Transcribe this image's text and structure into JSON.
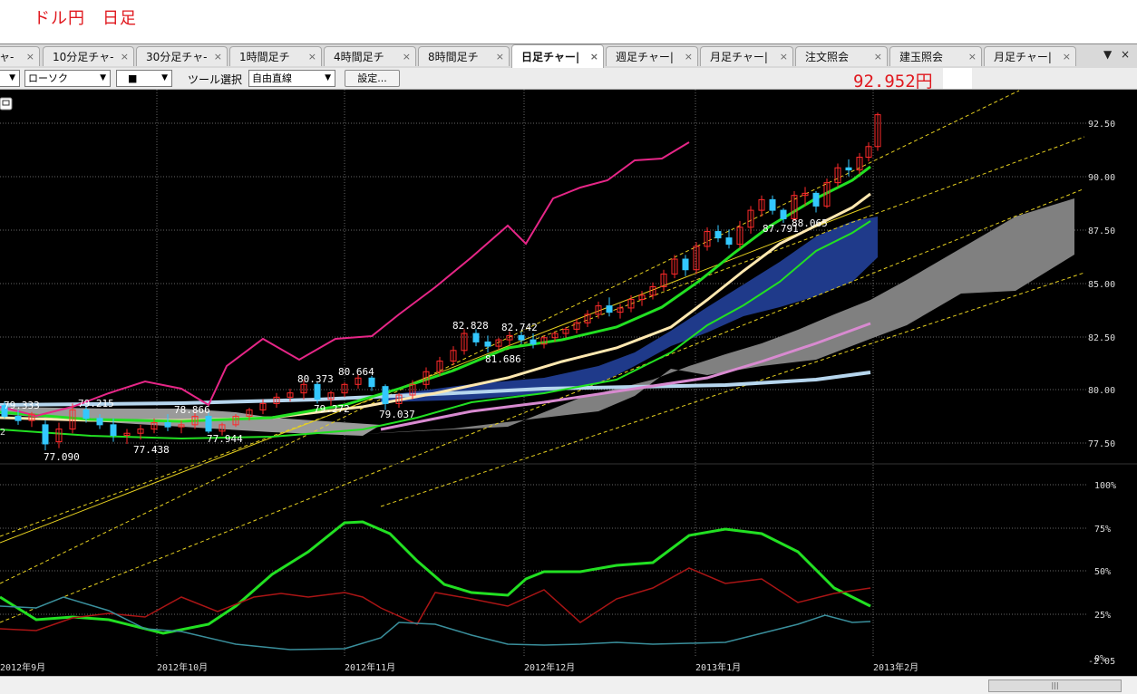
{
  "page_title": "ドル円　日足",
  "tabs": [
    {
      "label": "ャ-",
      "active": false
    },
    {
      "label": "10分足チャ-",
      "active": false
    },
    {
      "label": "30分足チャ-",
      "active": false
    },
    {
      "label": "1時間足チ",
      "active": false
    },
    {
      "label": "4時間足チ",
      "active": false
    },
    {
      "label": "8時間足チ",
      "active": false
    },
    {
      "label": "日足チャー|",
      "active": true
    },
    {
      "label": "週足チャー|",
      "active": false
    },
    {
      "label": "月足チャー|",
      "active": false
    },
    {
      "label": "注文照会",
      "active": false
    },
    {
      "label": "建玉照会",
      "active": false
    },
    {
      "label": "月足チャー|",
      "active": false
    }
  ],
  "tab_close": "×",
  "tab_nav": {
    "menu": "▼",
    "close": "×"
  },
  "toolbar": {
    "chart_type": "ローソク",
    "style_select": "■",
    "tool_label": "ツール選択",
    "tool_value": "自由直線",
    "settings_label": "設定..."
  },
  "current_price": "92.952円",
  "collapse_icon": "collapse-icon",
  "scroll_thumb_grip": "|||",
  "colors": {
    "background": "#000000",
    "grid": "#666666",
    "up_candle": "#ff2a2a",
    "down_candle": "#33c8ff",
    "rsi_line": "#e62687",
    "cloud": "#808080",
    "band": "#1f3a8a",
    "ma_short": "#22e022",
    "ma_mid": "#ffe8b0",
    "ma_long_pink": "#d88ad0",
    "ma_long_blue": "#b6d6ee",
    "trend_lines": "#e6d020",
    "stoch_k": "#22e022",
    "stoch_d": "#aa1515",
    "stoch_e": "#3a8f9c"
  },
  "chart_data": {
    "type": "candlestick",
    "price_axis": {
      "ticks": [
        "92.50",
        "90.00",
        "87.50",
        "85.00",
        "82.50",
        "80.00",
        "77.50"
      ],
      "ylim": [
        75.0,
        93.9
      ]
    },
    "osc_axis": {
      "ticks": [
        "100%",
        "75%",
        "50%",
        "25%",
        "0%"
      ],
      "ylim": [
        0,
        100
      ]
    },
    "x_labels": [
      "2012年9月",
      "2012年10月",
      "2012年11月",
      "2012年12月",
      "2013年1月",
      "2013年2月"
    ],
    "price_annotations": [
      "79.333",
      "79.215",
      "78.866",
      "77.090",
      "77.438",
      "77.944",
      "80.373",
      "80.664",
      "79.272",
      "79.037",
      "82.828",
      "82.742",
      "81.686",
      "87.791",
      "88.065"
    ],
    "bottom_right_fragment": "-2.05",
    "left_edge_fragment": "2",
    "current_close": 92.952
  }
}
